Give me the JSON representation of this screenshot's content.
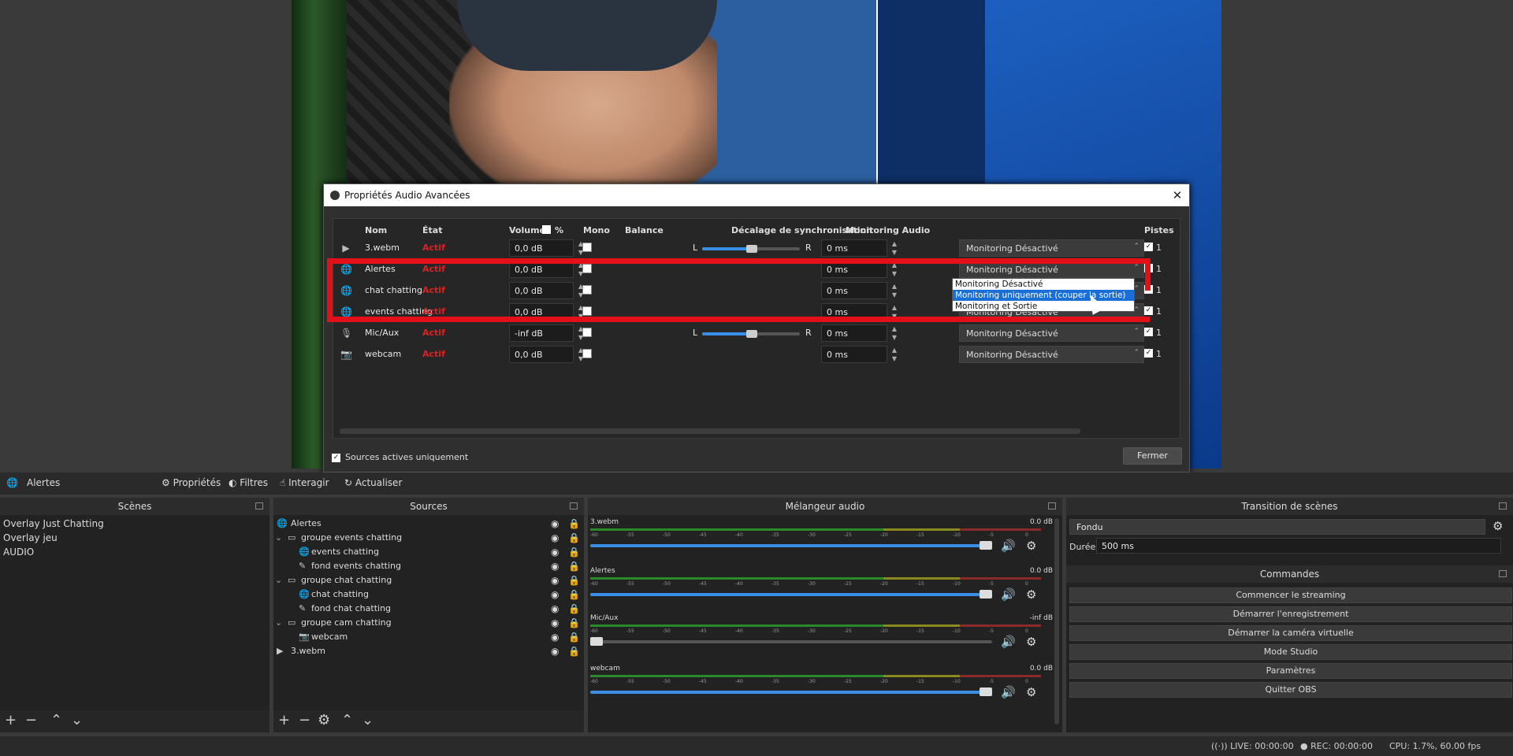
{
  "dialog": {
    "title": "Propriétés Audio Avancées",
    "close": "✕",
    "headers": {
      "name": "Nom",
      "state": "État",
      "volume": "Volume",
      "percent": "%",
      "mono": "Mono",
      "balance": "Balance",
      "sync": "Décalage de synchronisation",
      "monitoring": "Monitoring Audio",
      "tracks": "Pistes"
    },
    "rows": [
      {
        "icon": "▶",
        "name": "3.webm",
        "state": "Actif",
        "volume": "0,0 dB",
        "balance": true,
        "sync": "0 ms",
        "monitoring": "Monitoring Désactivé"
      },
      {
        "icon": "🌐",
        "name": "Alertes",
        "state": "Actif",
        "volume": "0,0 dB",
        "balance": false,
        "sync": "0 ms",
        "monitoring": "Monitoring Désactivé"
      },
      {
        "icon": "🌐",
        "name": "chat chatting",
        "state": "Actif",
        "volume": "0,0 dB",
        "balance": false,
        "sync": "0 ms",
        "monitoring": "Monitoring Désactivé"
      },
      {
        "icon": "🌐",
        "name": "events chatting",
        "state": "Actif",
        "volume": "0,0 dB",
        "balance": false,
        "sync": "0 ms",
        "monitoring": "Monitoring Désactivé"
      },
      {
        "icon": "🎙",
        "name": "Mic/Aux",
        "state": "Actif",
        "volume": "-inf dB",
        "balance": true,
        "sync": "0 ms",
        "monitoring": "Monitoring Désactivé"
      },
      {
        "icon": "📷",
        "name": "webcam",
        "state": "Actif",
        "volume": "0,0 dB",
        "balance": false,
        "sync": "0 ms",
        "monitoring": "Monitoring Désactivé"
      }
    ],
    "balance_l": "L",
    "balance_r": "R",
    "track_label": "1",
    "sources_active": "Sources actives uniquement",
    "close_button": "Fermer"
  },
  "dropdown": {
    "options": [
      "Monitoring Désactivé",
      "Monitoring uniquement (couper la sortie)",
      "Monitoring et Sortie"
    ],
    "selected_index": 1
  },
  "toolbar": {
    "source": "Alertes",
    "properties": "Propriétés",
    "filters": "Filtres",
    "interact": "Interagir",
    "refresh": "Actualiser"
  },
  "scenes": {
    "title": "Scènes",
    "items": [
      "Overlay Just Chatting",
      "Overlay jeu",
      "AUDIO"
    ]
  },
  "sources": {
    "title": "Sources",
    "items": [
      {
        "name": "Alertes",
        "indent": 0
      },
      {
        "name": "groupe events chatting",
        "indent": 1
      },
      {
        "name": "events chatting",
        "indent": 2
      },
      {
        "name": "fond events chatting",
        "indent": 2
      },
      {
        "name": "groupe chat chatting",
        "indent": 1
      },
      {
        "name": "chat chatting",
        "indent": 2
      },
      {
        "name": "fond chat chatting",
        "indent": 2
      },
      {
        "name": "groupe cam chatting",
        "indent": 1
      },
      {
        "name": "webcam",
        "indent": 2
      },
      {
        "name": "3.webm",
        "indent": 0
      }
    ]
  },
  "mixer": {
    "title": "Mélangeur audio",
    "scale": [
      "-60",
      "-55",
      "-50",
      "-45",
      "-40",
      "-35",
      "-30",
      "-25",
      "-20",
      "-15",
      "-10",
      "-5",
      "0"
    ],
    "channels": [
      {
        "name": "3.webm",
        "db": "0.0 dB",
        "level": 1.0
      },
      {
        "name": "Alertes",
        "db": "0.0 dB",
        "level": 1.0
      },
      {
        "name": "Mic/Aux",
        "db": "-inf dB",
        "level": 0.0
      },
      {
        "name": "webcam",
        "db": "0.0 dB",
        "level": 1.0
      }
    ]
  },
  "transition": {
    "title": "Transition de scènes",
    "type": "Fondu",
    "duration_label": "Durée",
    "duration": "500 ms"
  },
  "commands": {
    "title": "Commandes",
    "buttons": [
      "Commencer le streaming",
      "Démarrer l'enregistrement",
      "Démarrer la caméra virtuelle",
      "Mode Studio",
      "Paramètres",
      "Quitter OBS"
    ]
  },
  "status": {
    "live": "LIVE: 00:00:00",
    "rec": "REC: 00:00:00",
    "cpu": "CPU: 1.7%, 60.00 fps"
  },
  "colors": {
    "accent": "#3a8ee6",
    "highlight": "#e3101a",
    "state_red": "#e02020"
  }
}
